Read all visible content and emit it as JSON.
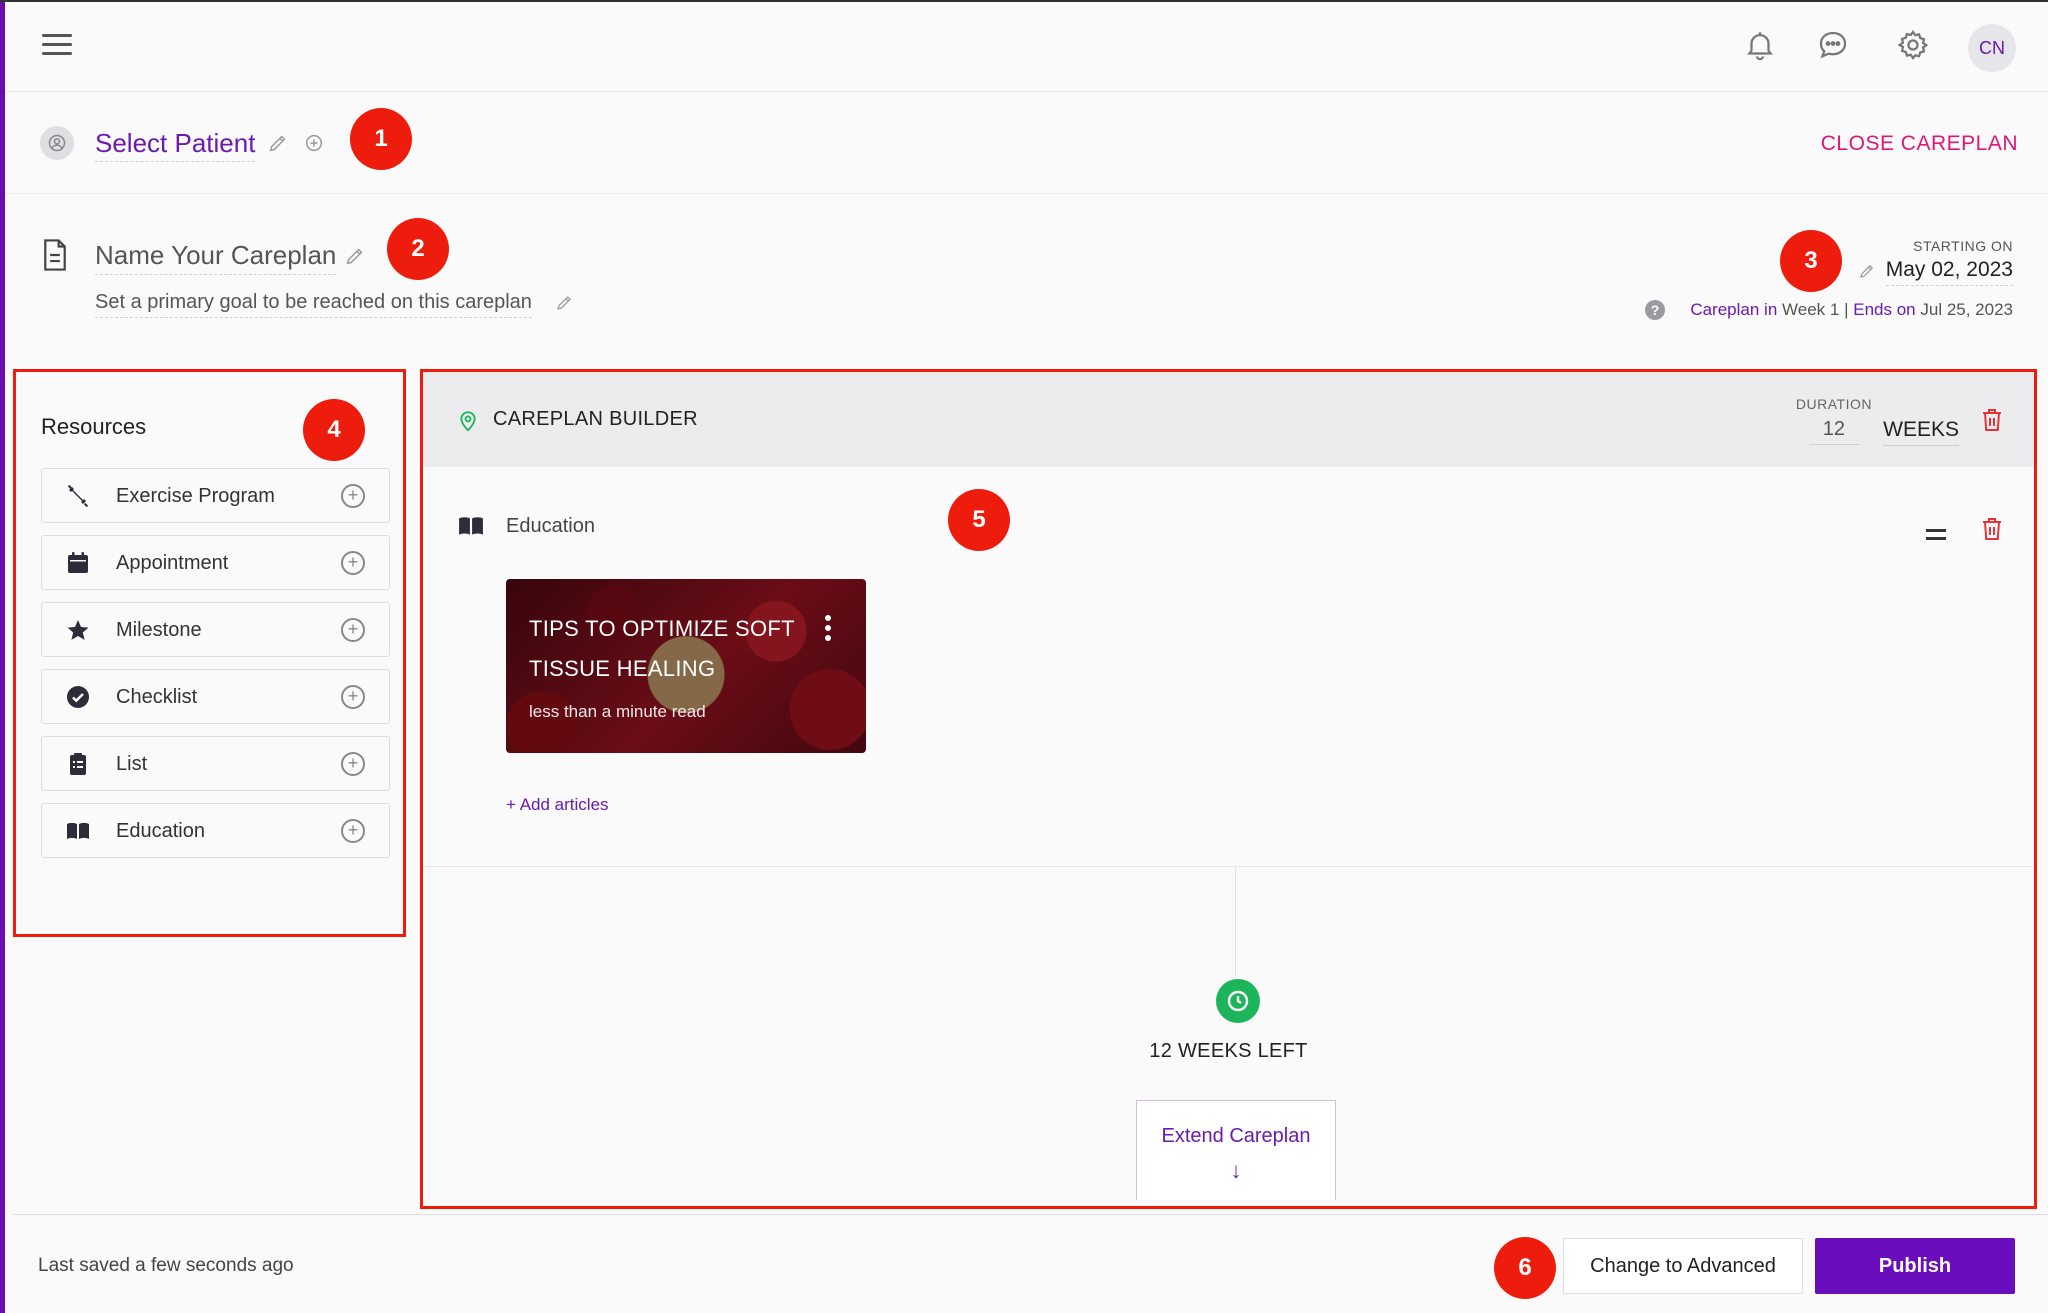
{
  "header": {
    "avatar_initials": "CN",
    "icons": [
      "menu-icon",
      "bell-icon",
      "chat-icon",
      "gear-icon"
    ]
  },
  "patient": {
    "select_label": "Select Patient",
    "close_label": "CLOSE CAREPLAN"
  },
  "careplan": {
    "name_placeholder": "Name Your Careplan",
    "goal_placeholder": "Set a primary goal to be reached on this careplan",
    "starting_label": "STARTING ON",
    "starting_date": "May 02, 2023",
    "status_prefix": "Careplan in",
    "status_week": "Week 1",
    "status_sep": "|",
    "status_ends_label": "Ends on",
    "status_end_date": "Jul 25, 2023"
  },
  "badges": [
    "1",
    "2",
    "3",
    "4",
    "5",
    "6"
  ],
  "resources": {
    "title": "Resources",
    "items": [
      {
        "label": "Exercise Program",
        "icon": "dumbbell-icon"
      },
      {
        "label": "Appointment",
        "icon": "calendar-icon"
      },
      {
        "label": "Milestone",
        "icon": "star-icon"
      },
      {
        "label": "Checklist",
        "icon": "check-circle-icon"
      },
      {
        "label": "List",
        "icon": "clipboard-icon"
      },
      {
        "label": "Education",
        "icon": "book-icon"
      }
    ]
  },
  "builder": {
    "title": "CAREPLAN BUILDER",
    "duration_label": "DURATION",
    "duration_value": "12",
    "duration_unit": "WEEKS",
    "education": {
      "label": "Education",
      "article_title": "TIPS TO OPTIMIZE SOFT TISSUE HEALING",
      "article_meta": "less than a minute read",
      "add_articles": "+ Add articles"
    },
    "weeks_left": "12 WEEKS LEFT",
    "extend_label": "Extend Careplan",
    "extend_arrow": "↓"
  },
  "footer": {
    "last_saved": "Last saved a few seconds ago",
    "advanced_label": "Change to Advanced",
    "publish_label": "Publish"
  },
  "colors": {
    "brand": "#6a0dbd",
    "accent_pink": "#e0167a",
    "annotation_red": "#ee1c0c",
    "success_green": "#1cb55a"
  }
}
